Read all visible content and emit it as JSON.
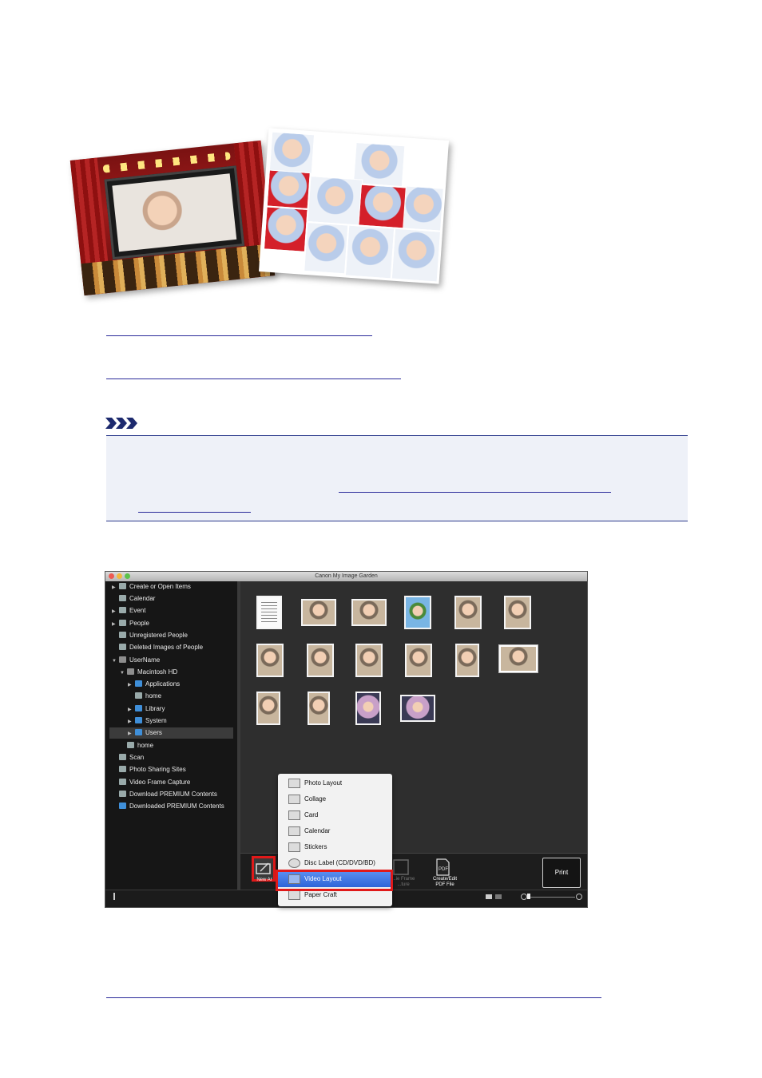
{
  "app": {
    "title": "Canon My Image Garden",
    "sidebar": [
      {
        "label": "Create or Open Items",
        "arrow": "▶",
        "indent": 0
      },
      {
        "label": "Calendar",
        "arrow": "",
        "indent": 0
      },
      {
        "label": "Event",
        "arrow": "▶",
        "indent": 0
      },
      {
        "label": "People",
        "arrow": "▶",
        "indent": 0
      },
      {
        "label": "Unregistered People",
        "arrow": "",
        "indent": 0
      },
      {
        "label": "Deleted Images of People",
        "arrow": "",
        "indent": 0
      },
      {
        "label": "UserName",
        "arrow": "▼",
        "indent": 0
      },
      {
        "label": "Macintosh HD",
        "arrow": "▼",
        "indent": 1
      },
      {
        "label": "Applications",
        "arrow": "▶",
        "indent": 2
      },
      {
        "label": "home",
        "arrow": "",
        "indent": 2
      },
      {
        "label": "Library",
        "arrow": "▶",
        "indent": 2
      },
      {
        "label": "System",
        "arrow": "▶",
        "indent": 2
      },
      {
        "label": "Users",
        "arrow": "▶",
        "indent": 2
      },
      {
        "label": "home",
        "arrow": "",
        "indent": 1
      },
      {
        "label": "Scan",
        "arrow": "",
        "indent": 0
      },
      {
        "label": "Photo Sharing Sites",
        "arrow": "",
        "indent": 0
      },
      {
        "label": "Video Frame Capture",
        "arrow": "",
        "indent": 0
      },
      {
        "label": "Download PREMIUM Contents",
        "arrow": "",
        "indent": 0
      },
      {
        "label": "Downloaded PREMIUM Contents",
        "arrow": "",
        "indent": 0
      }
    ],
    "toolbar": {
      "new_art": "New Ar",
      "video_frame_capture": "...ie Frame\n...ture",
      "create_edit_pdf": "Create/Edit\nPDF File",
      "print": "Print"
    },
    "menu": [
      "Photo Layout",
      "Collage",
      "Card",
      "Calendar",
      "Stickers",
      "Disc Label (CD/DVD/BD)",
      "Video Layout",
      "Paper Craft"
    ],
    "menu_highlighted": "Video Layout",
    "accent_color": "#e01919",
    "highlight_color": "#2d64d8"
  }
}
